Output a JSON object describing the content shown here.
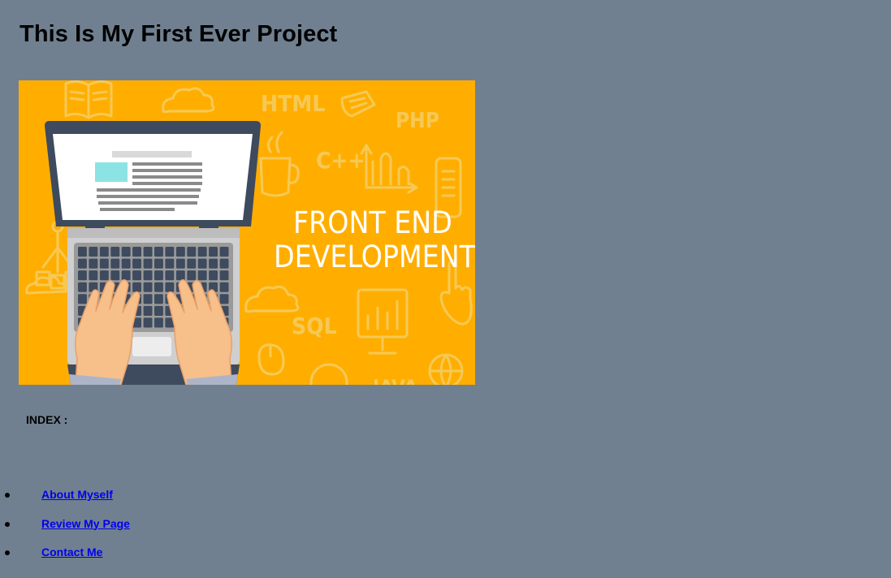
{
  "page": {
    "title": "This Is My First Ever Project",
    "background_color": "#708090"
  },
  "hero": {
    "background_color": "#FFAE00",
    "doodle_color": "#F6C956",
    "headline_line1": "FRONT END",
    "headline_line2": "DEVELOPMENT",
    "doodle_labels": [
      "HTML",
      "PHP",
      "C++",
      "SQL",
      "JAVA"
    ],
    "icons": [
      "laptop-icon",
      "book-icon",
      "cloud-icon",
      "coffee-icon",
      "chart-icon",
      "monitor-icon",
      "globe-icon",
      "phone-icon",
      "hand-icon",
      "tag-icon"
    ]
  },
  "index": {
    "label": "INDEX :"
  },
  "nav": {
    "items": [
      {
        "label": "About Myself"
      },
      {
        "label": "Review My Page"
      },
      {
        "label": "Contact Me"
      }
    ],
    "link_color": "#0000EE"
  }
}
